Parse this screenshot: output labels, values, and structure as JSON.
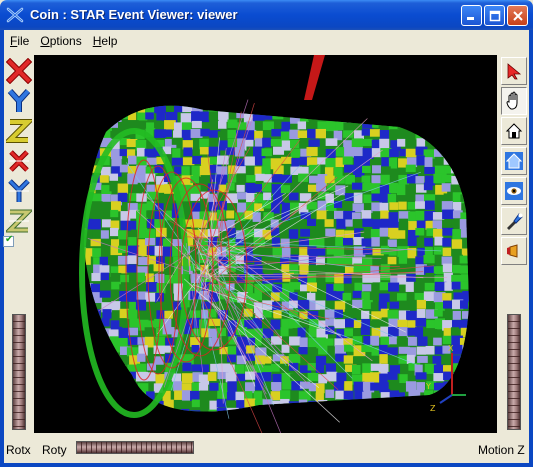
{
  "window": {
    "title": "Coin : STAR Event Viewer: viewer",
    "controls": [
      "minimize-icon",
      "maximize-icon",
      "close-icon"
    ]
  },
  "menu": {
    "items": [
      {
        "label": "File",
        "accel": "F",
        "rest": "ile"
      },
      {
        "label": "Options",
        "accel": "O",
        "rest": "ptions"
      },
      {
        "label": "Help",
        "accel": "H",
        "rest": "elp"
      }
    ]
  },
  "left_toolbar": {
    "buttons": [
      {
        "icon": "x-axis-view-icon",
        "letter": "X",
        "color": "#D22020"
      },
      {
        "icon": "y-axis-view-icon",
        "letter": "Y",
        "color": "#2060D0"
      },
      {
        "icon": "z-axis-view-icon",
        "letter": "Z",
        "color": "#B8B020"
      },
      {
        "icon": "x-axis-reverse-view-icon",
        "letter": "X",
        "color": "#D22020"
      },
      {
        "icon": "y-axis-reverse-view-icon",
        "letter": "Y",
        "color": "#2060D0"
      },
      {
        "icon": "z-axis-reverse-view-icon",
        "letter": "Z",
        "color": "#B8B020"
      }
    ],
    "checkbox_checked": true
  },
  "right_toolbar": {
    "buttons": [
      {
        "icon": "select-arrow-icon"
      },
      {
        "icon": "view-hand-icon"
      },
      {
        "icon": "home-icon"
      },
      {
        "icon": "set-home-icon"
      },
      {
        "icon": "view-all-eye-icon"
      },
      {
        "icon": "seek-flashlight-icon"
      },
      {
        "icon": "perspective-toggle-icon"
      }
    ]
  },
  "axis_gizmo": {
    "x": "X",
    "y": "Y",
    "z": "Z"
  },
  "bottom": {
    "rotx_label": "Rotx",
    "roty_label": "Roty",
    "motion_label": "Motion Z"
  },
  "colors": {
    "titlebar": "#0A4CD1",
    "chrome": "#ECE9D8",
    "viewer_bg": "#000000"
  }
}
